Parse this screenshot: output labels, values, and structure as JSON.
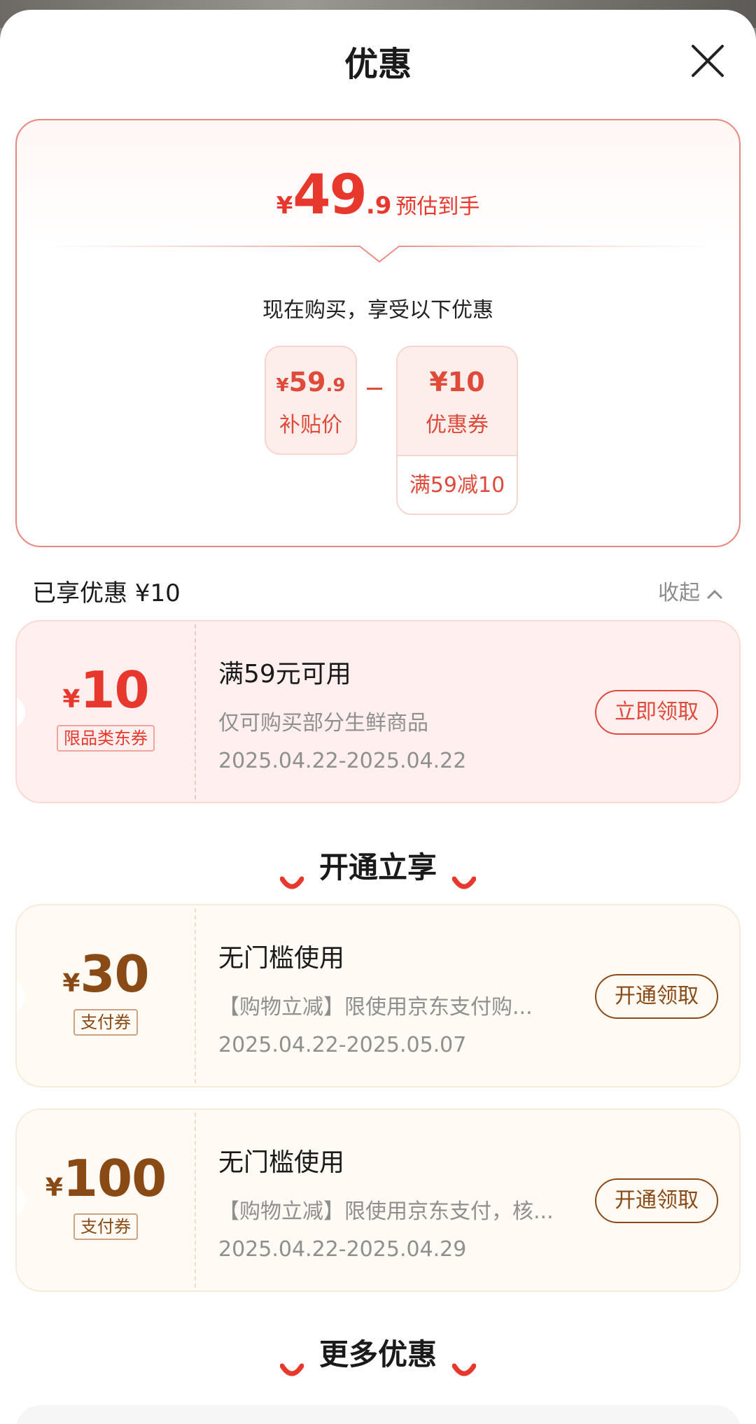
{
  "sheet": {
    "title": "优惠",
    "close_icon": "close-icon"
  },
  "summary": {
    "currency": "¥",
    "estimate_int": "49",
    "estimate_dec": ".9",
    "estimate_label": "预估到手",
    "benefit_title": "现在购买，享受以下优惠",
    "subsidy": {
      "currency": "¥",
      "int": "59",
      "dec": ".9",
      "label": "补贴价"
    },
    "coupon": {
      "value": "¥10",
      "label": "优惠券",
      "condition": "满59减10"
    }
  },
  "enjoyed": {
    "label": "已享优惠 ¥10",
    "collapse_label": "收起"
  },
  "coupons_enjoyed": [
    {
      "currency": "¥",
      "amount": "10",
      "tag": "限品类东券",
      "title": "满59元可用",
      "desc": "仅可购买部分生鲜商品",
      "date": "2025.04.22-2025.04.22",
      "button": "立即领取"
    }
  ],
  "section_open": {
    "title": "开通立享"
  },
  "coupons_open": [
    {
      "currency": "¥",
      "amount": "30",
      "tag": "支付券",
      "title": "无门槛使用",
      "desc": "【购物立减】限使用京东支付购...",
      "date": "2025.04.22-2025.05.07",
      "button": "开通领取"
    },
    {
      "currency": "¥",
      "amount": "100",
      "tag": "支付券",
      "title": "无门槛使用",
      "desc": "【购物立减】限使用京东支付，核...",
      "date": "2025.04.22-2025.04.29",
      "button": "开通领取"
    }
  ],
  "section_more": {
    "title": "更多优惠"
  },
  "colors": {
    "accent_red": "#e8372c",
    "accent_gold": "#8a4a16"
  }
}
